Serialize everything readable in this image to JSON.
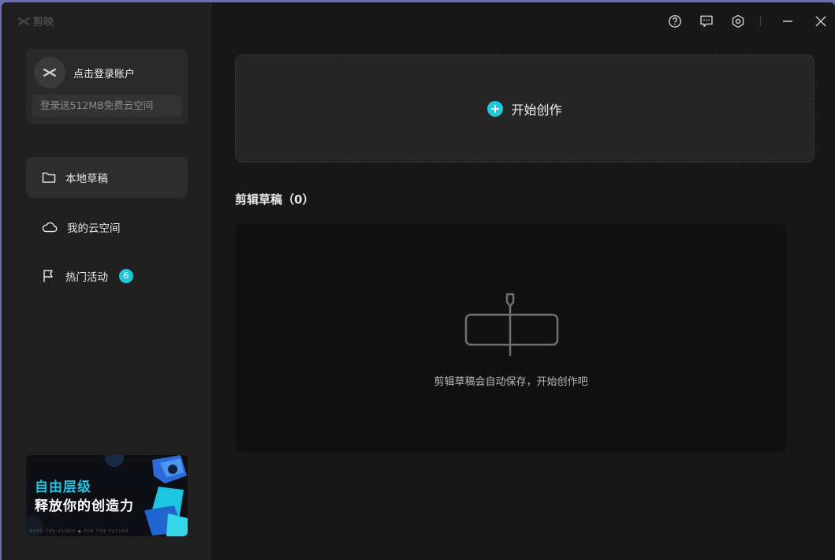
{
  "app": {
    "logo_text": "剪映"
  },
  "account": {
    "login_label": "点击登录账户",
    "promo": "登录送512MB免费云空间"
  },
  "nav": {
    "items": [
      {
        "label": "本地草稿",
        "icon": "folder-icon",
        "active": true
      },
      {
        "label": "我的云空间",
        "icon": "cloud-icon",
        "active": false
      },
      {
        "label": "热门活动",
        "icon": "flag-icon",
        "active": false,
        "badge": "6"
      }
    ]
  },
  "banner": {
    "line1": "自由层级",
    "line2": "释放你的创造力",
    "footer": "MAKE THE V1DEO ● FOR THE FUTURE"
  },
  "toolbar": {
    "icons": [
      "help-icon",
      "feedback-icon",
      "settings-icon",
      "minimize-icon",
      "close-icon"
    ]
  },
  "main": {
    "create_label": "开始创作",
    "drafts_title": "剪辑草稿（0）",
    "empty_text": "剪辑草稿会自动保存，开始创作吧"
  },
  "colors": {
    "accent": "#1ec8d8",
    "background": "#181818",
    "sidebar": "#202020"
  }
}
